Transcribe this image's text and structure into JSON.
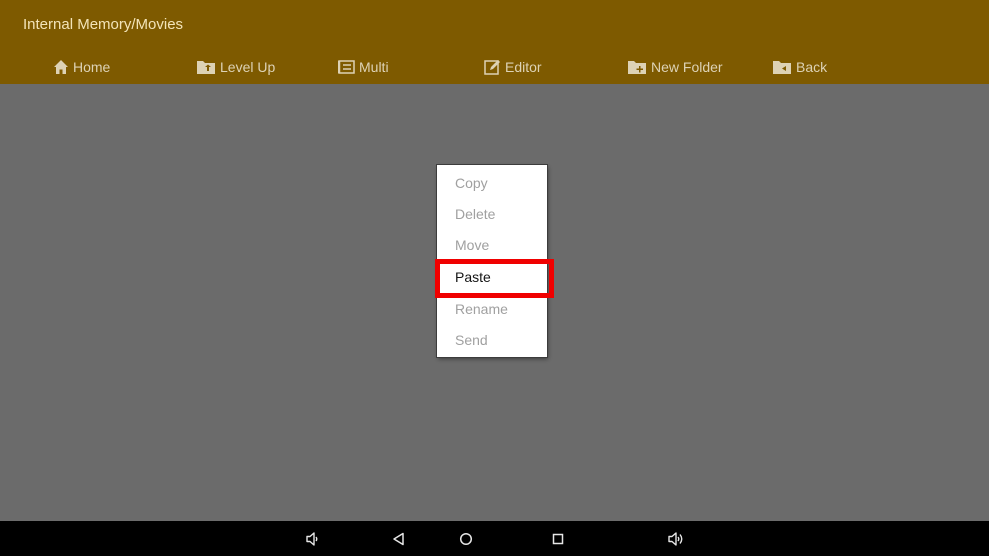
{
  "header": {
    "path_title": "Internal Memory/Movies"
  },
  "toolbar": {
    "items": [
      {
        "label": "Home",
        "icon": "home-icon"
      },
      {
        "label": "Level Up",
        "icon": "folder-up-icon"
      },
      {
        "label": "Multi",
        "icon": "multi-select-icon"
      },
      {
        "label": "Editor",
        "icon": "edit-icon"
      },
      {
        "label": "New Folder",
        "icon": "new-folder-icon"
      },
      {
        "label": "Back",
        "icon": "folder-back-icon"
      }
    ]
  },
  "context_menu": {
    "items": [
      {
        "label": "Copy",
        "enabled": false
      },
      {
        "label": "Delete",
        "enabled": false
      },
      {
        "label": "Move",
        "enabled": false
      },
      {
        "label": "Paste",
        "enabled": true,
        "highlighted": true
      },
      {
        "label": "Rename",
        "enabled": false
      },
      {
        "label": "Send",
        "enabled": false
      }
    ]
  },
  "navbar": {
    "buttons": [
      "volume-down-icon",
      "back-triangle-icon",
      "home-circle-icon",
      "recents-square-icon",
      "volume-up-icon"
    ]
  },
  "colors": {
    "header_bg": "#7e5a00",
    "overlay_bg": "#6b6b6b",
    "highlight": "#f00000"
  }
}
